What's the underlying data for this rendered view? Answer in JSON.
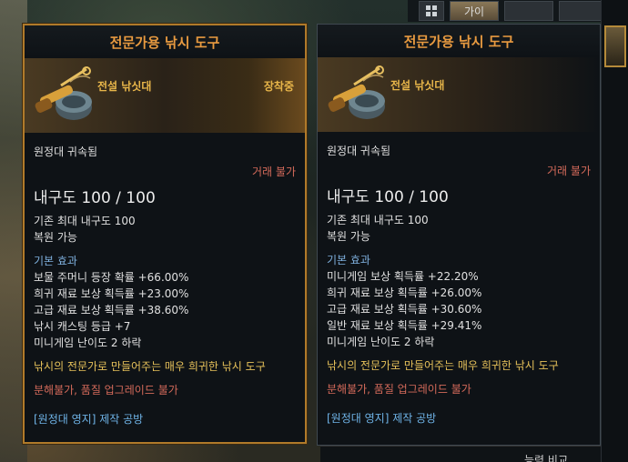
{
  "topbar": {
    "tab2_label": "가이",
    "tab3_label": "",
    "tab4_label": ""
  },
  "lower_panel": {
    "label": "능력 비교"
  },
  "tooltips": [
    {
      "title": "전문가용 낚시 도구",
      "tier": "전설 낚싯대",
      "equipped": "장착중",
      "bound": "원정대 귀속됨",
      "trade": "거래 불가",
      "durability": "내구도 100 / 100",
      "max_durability": "기존 최대 내구도 100",
      "restorable": "복원 가능",
      "effects_title": "기본 효과",
      "effects": [
        "보물 주머니 등장 확률 +66.00%",
        "희귀 재료 보상 획득률 +23.00%",
        "고급 재료 보상 획득률 +38.60%",
        "낚시 캐스팅 등급 +7",
        "미니게임 난이도 2 하락"
      ],
      "description": "낚시의 전문가로 만들어주는 매우 희귀한 낚시 도구",
      "restrictions": "분해불가, 품질 업그레이드 불가",
      "source": "[원정대 영지] 제작 공방"
    },
    {
      "title": "전문가용 낚시 도구",
      "tier": "전설 낚싯대",
      "bound": "원정대 귀속됨",
      "trade": "거래 불가",
      "durability": "내구도 100 / 100",
      "max_durability": "기존 최대 내구도 100",
      "restorable": "복원 가능",
      "effects_title": "기본 효과",
      "effects": [
        "미니게임 보상 획득률 +22.20%",
        "희귀 재료 보상 획득률 +26.00%",
        "고급 재료 보상 획득률 +30.60%",
        "일반 재료 보상 획득률 +29.41%",
        "미니게임 난이도 2 하락"
      ],
      "description": "낚시의 전문가로 만들어주는 매우 희귀한 낚시 도구",
      "restrictions": "분해불가, 품질 업그레이드 불가",
      "source": "[원정대 영지] 제작 공방"
    }
  ],
  "colors": {
    "title": "#e89a40",
    "tier": "#e8b64a",
    "trade": "#d46a5a",
    "section": "#7fb0de",
    "description": "#e6c15a",
    "source": "#6fb4e8",
    "equipped_border": "#b07a2a"
  },
  "icons": [
    "fishing-rod-icon",
    "grid-icon",
    "slot-icon"
  ]
}
